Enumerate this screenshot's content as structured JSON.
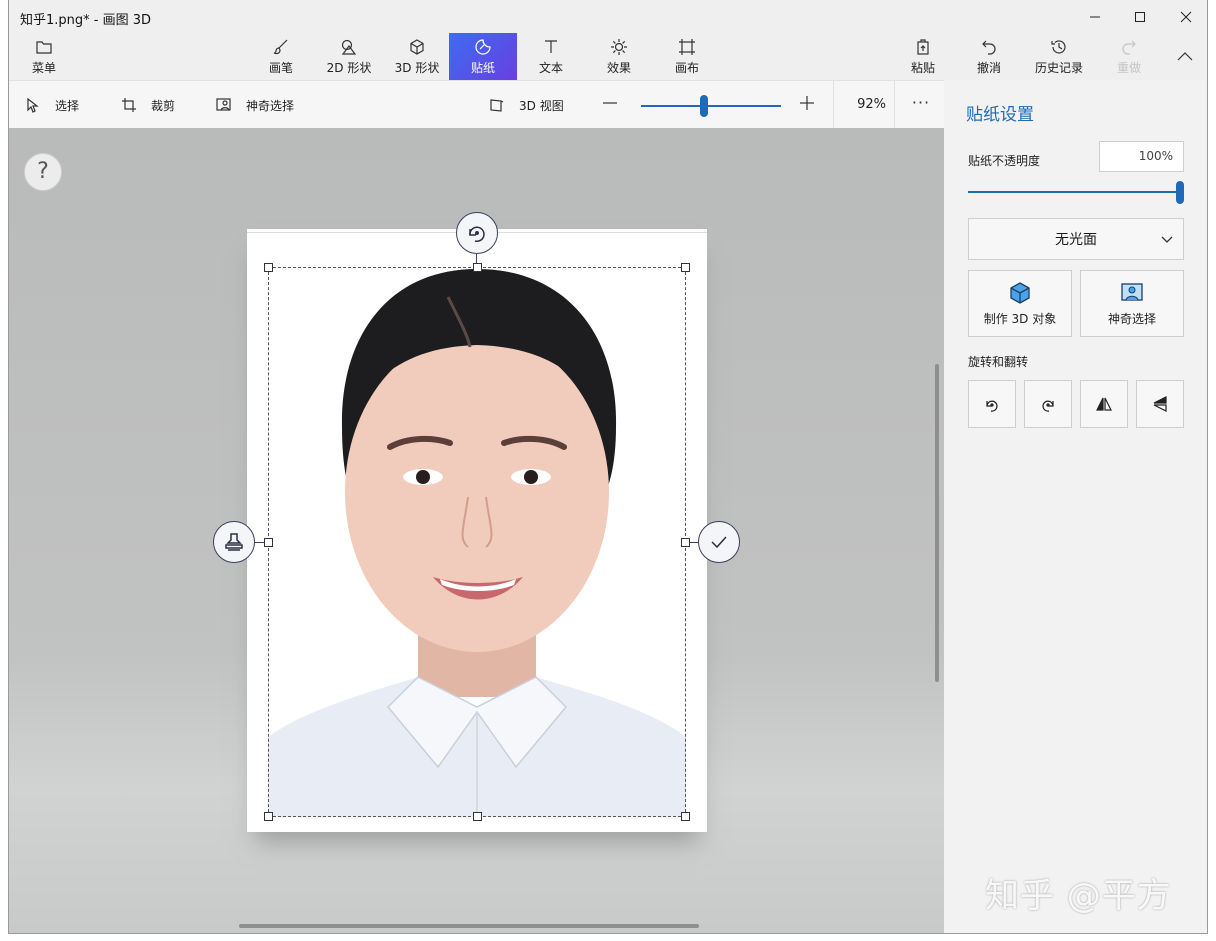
{
  "window": {
    "title": "知乎1.png* - 画图 3D",
    "controls": [
      "minimize",
      "maximize",
      "close"
    ]
  },
  "ribbon": {
    "menu_label": "菜单",
    "tabs": [
      {
        "label": "画笔",
        "icon": "brush-icon"
      },
      {
        "label": "2D 形状",
        "icon": "shapes-2d-icon"
      },
      {
        "label": "3D 形状",
        "icon": "cube-icon"
      },
      {
        "label": "贴纸",
        "icon": "sticker-icon",
        "active": true
      },
      {
        "label": "文本",
        "icon": "text-icon"
      },
      {
        "label": "效果",
        "icon": "effects-icon"
      },
      {
        "label": "画布",
        "icon": "canvas-icon"
      }
    ],
    "right": [
      {
        "label": "粘贴",
        "icon": "paste-icon"
      },
      {
        "label": "撤消",
        "icon": "undo-icon"
      },
      {
        "label": "历史记录",
        "icon": "history-icon"
      },
      {
        "label": "重做",
        "icon": "redo-icon",
        "disabled": true
      }
    ]
  },
  "toolbar": {
    "select_label": "选择",
    "crop_label": "裁剪",
    "magic_select_label": "神奇选择",
    "view3d_label": "3D 视图",
    "zoom_value": "92%",
    "zoom_fraction": 0.47,
    "more_label": "···"
  },
  "canvas": {
    "help_label": "?",
    "sticker": {
      "description_icon": "portrait-photo"
    }
  },
  "panel": {
    "title": "贴纸设置",
    "opacity_label": "贴纸不透明度",
    "opacity_value": "100%",
    "opacity_fraction": 1.0,
    "finish_value": "无光面",
    "make3d_label": "制作 3D 对象",
    "magic_select_label": "神奇选择",
    "rotate_flip_label": "旋转和翻转"
  },
  "watermark": "知乎 @平方",
  "colors": {
    "accent": "#1f6ab8",
    "active_tab_start": "#3b6df2",
    "active_tab_end": "#6a3ee0",
    "canvas_bg": "#bdbebe",
    "panel_bg": "#f2f2f2"
  }
}
